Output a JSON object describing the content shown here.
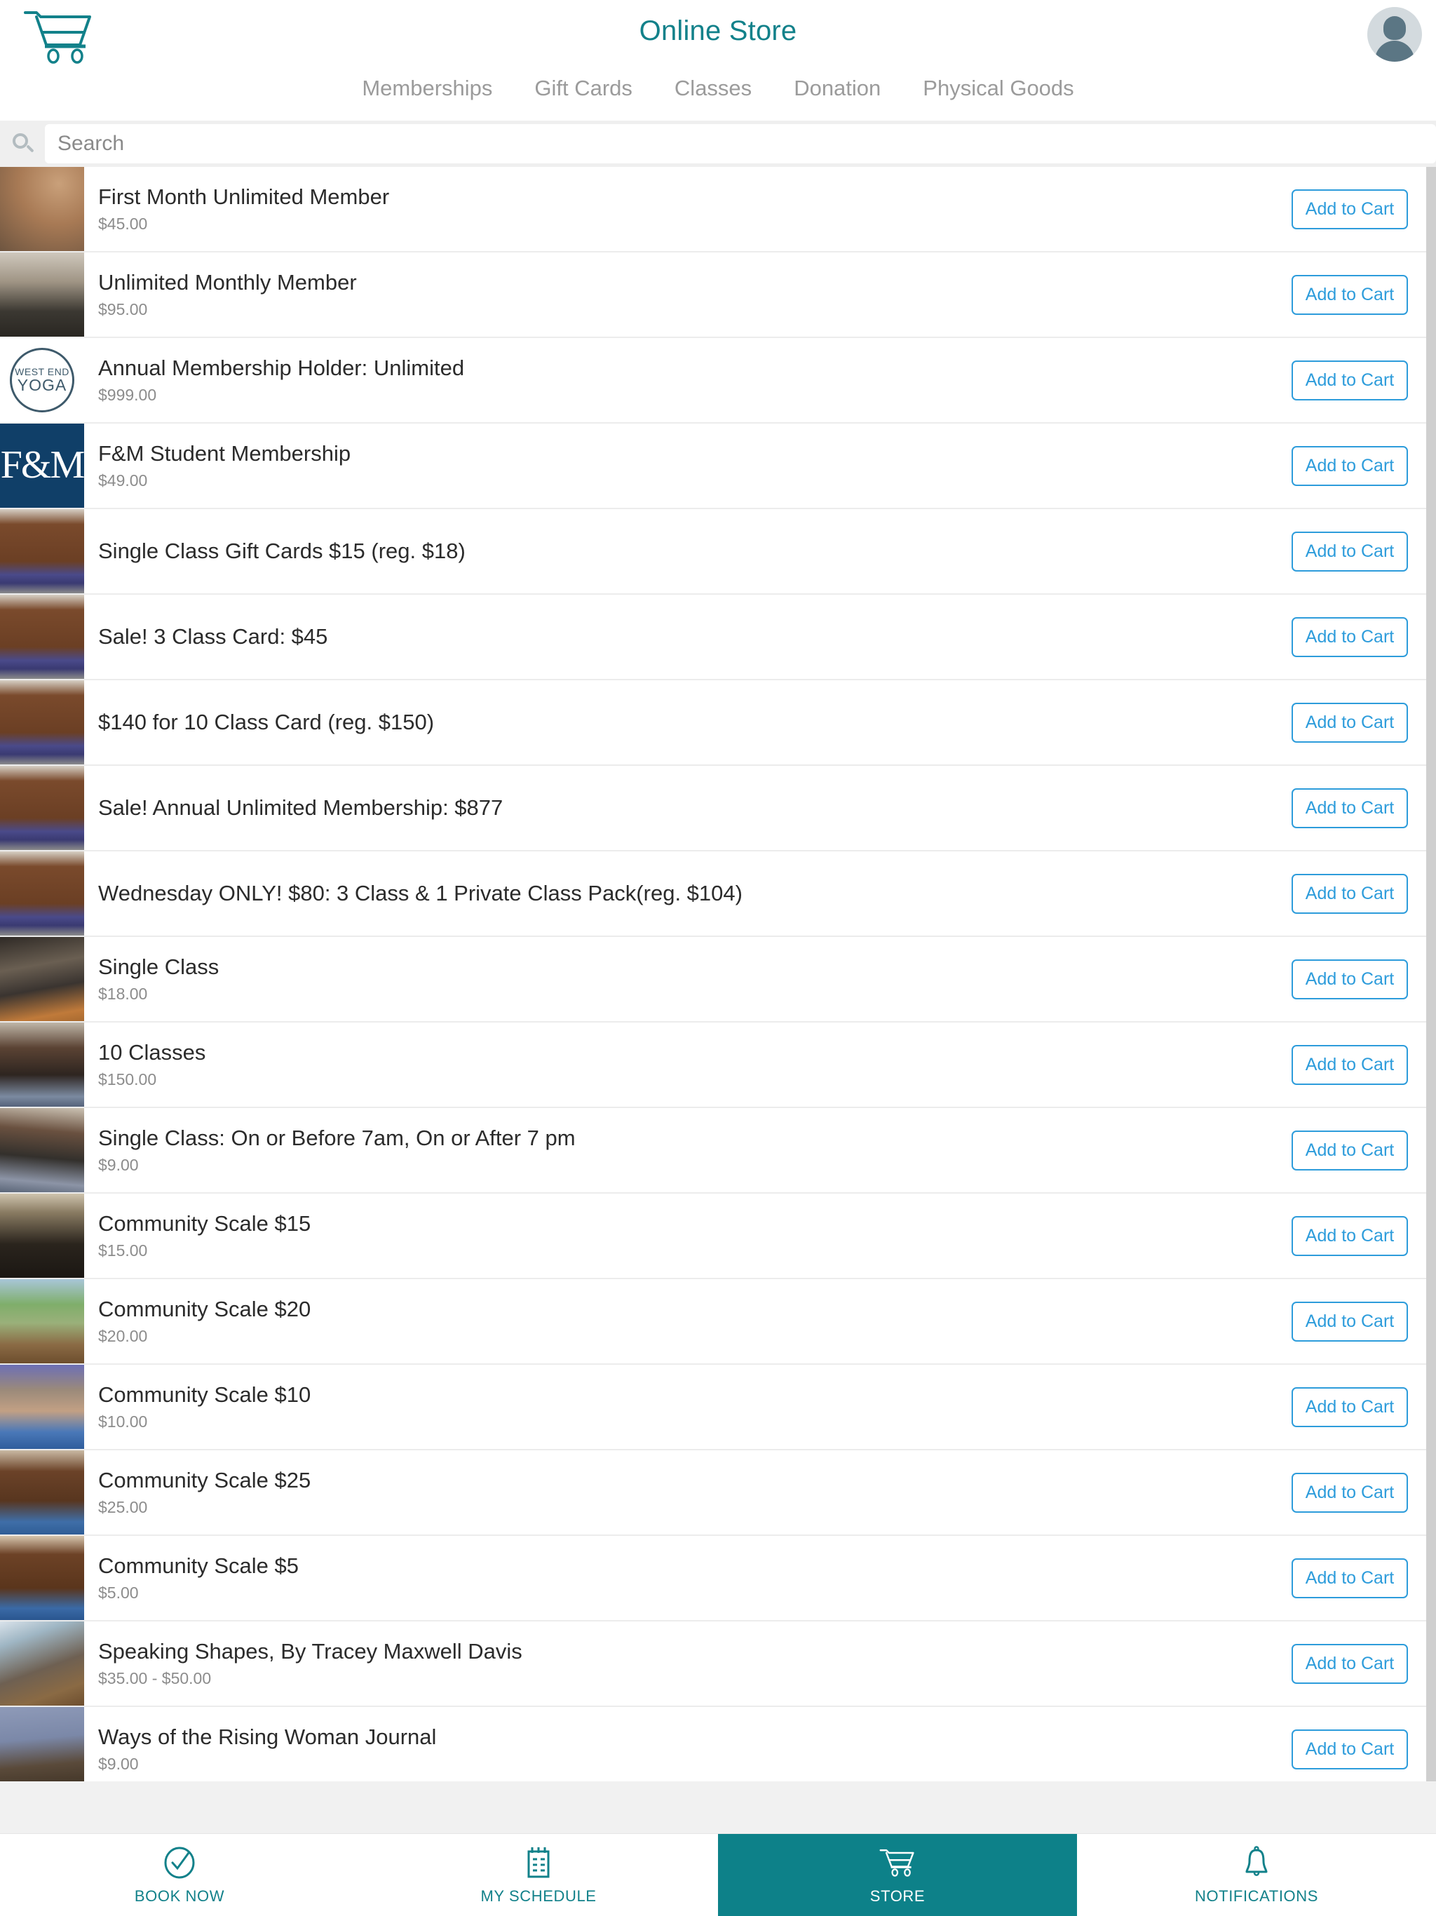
{
  "header": {
    "title": "Online Store",
    "cart_icon": "shopping-cart-icon",
    "avatar_icon": "user-avatar-icon",
    "tabs": [
      {
        "label": "Memberships"
      },
      {
        "label": "Gift Cards"
      },
      {
        "label": "Classes"
      },
      {
        "label": "Donation"
      },
      {
        "label": "Physical Goods"
      }
    ]
  },
  "search": {
    "placeholder": "Search",
    "value": "",
    "icon": "search-icon"
  },
  "colors": {
    "brand_teal": "#0d8189",
    "title_teal": "#12818a",
    "button_blue": "#2d9cdb",
    "tab_gray": "#9b9b9b",
    "price_gray": "#8c8c8c"
  },
  "add_to_cart_label": "Add to Cart",
  "products": [
    {
      "title": "First Month Unlimited Member",
      "price": "$45.00",
      "thumb": "t-yogamat",
      "button": "Add to Cart"
    },
    {
      "title": "Unlimited Monthly Member",
      "price": "$95.00",
      "thumb": "t-storefront",
      "button": "Add to Cart"
    },
    {
      "title": "Annual Membership Holder: Unlimited",
      "price": "$999.00",
      "thumb": "t-logo",
      "button": "Add to Cart"
    },
    {
      "title": "F&M Student Membership",
      "price": "$49.00",
      "thumb": "t-fm",
      "button": "Add to Cart"
    },
    {
      "title": "Single Class Gift Cards $15 (reg. $18)",
      "price": "",
      "thumb": "t-studio",
      "button": "Add to Cart"
    },
    {
      "title": "Sale! 3 Class Card: $45",
      "price": "",
      "thumb": "t-studio",
      "button": "Add to Cart"
    },
    {
      "title": "$140 for 10 Class Card (reg. $150)",
      "price": "",
      "thumb": "t-studio",
      "button": "Add to Cart"
    },
    {
      "title": "Sale! Annual Unlimited Membership: $877",
      "price": "",
      "thumb": "t-studio",
      "button": "Add to Cart"
    },
    {
      "title": "Wednesday ONLY! $80: 3 Class & 1 Private Class Pack(reg. $104)",
      "price": "",
      "thumb": "t-studio",
      "button": "Add to Cart"
    },
    {
      "title": "Single Class",
      "price": "$18.00",
      "thumb": "t-class1",
      "button": "Add to Cart"
    },
    {
      "title": "10 Classes",
      "price": "$150.00",
      "thumb": "t-class2",
      "button": "Add to Cart"
    },
    {
      "title": "Single Class: On or Before 7am, On or After 7 pm",
      "price": "$9.00",
      "thumb": "t-class3",
      "button": "Add to Cart"
    },
    {
      "title": "Community Scale $15",
      "price": "$15.00",
      "thumb": "t-room",
      "button": "Add to Cart"
    },
    {
      "title": "Community Scale $20",
      "price": "$20.00",
      "thumb": "t-plant",
      "button": "Add to Cart"
    },
    {
      "title": "Community Scale $10",
      "price": "$10.00",
      "thumb": "t-pose1",
      "button": "Add to Cart"
    },
    {
      "title": "Community Scale $25",
      "price": "$25.00",
      "thumb": "t-pose2",
      "button": "Add to Cart"
    },
    {
      "title": "Community Scale $5",
      "price": "$5.00",
      "thumb": "t-pose3",
      "button": "Add to Cart"
    },
    {
      "title": "Speaking Shapes, By Tracey Maxwell Davis",
      "price": "$35.00 - $50.00",
      "thumb": "t-book",
      "button": "Add to Cart"
    },
    {
      "title": "Ways of the Rising Woman Journal",
      "price": "$9.00",
      "thumb": "t-journal",
      "button": "Add to Cart"
    }
  ],
  "logo_thumb": {
    "line1": "WEST END",
    "line2": "YOGA"
  },
  "fm_thumb": {
    "line1": "F&M",
    "line2": "&"
  },
  "tabbar": {
    "items": [
      {
        "label": "BOOK NOW",
        "icon": "check-circle-icon",
        "active": false
      },
      {
        "label": "MY SCHEDULE",
        "icon": "calendar-icon",
        "active": false
      },
      {
        "label": "STORE",
        "icon": "shopping-cart-icon",
        "active": true
      },
      {
        "label": "NOTIFICATIONS",
        "icon": "bell-icon",
        "active": false
      }
    ]
  }
}
